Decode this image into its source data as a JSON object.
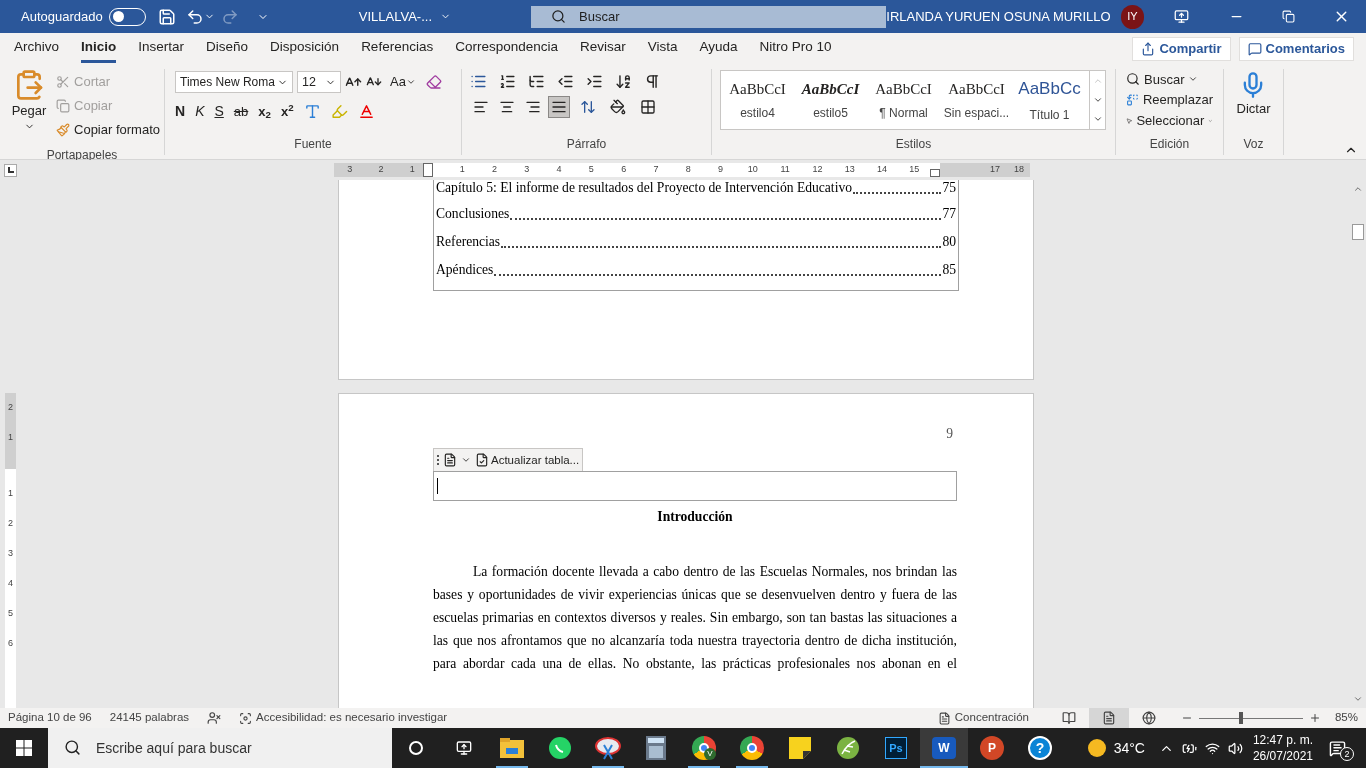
{
  "title_bar": {
    "autosave_label": "Autoguardado",
    "autosave_on": false,
    "file_name": "VILLALVA-...",
    "search_placeholder": "Buscar",
    "user_name": "IRLANDA YURUEN OSUNA MURILLO",
    "avatar_initials": "IY"
  },
  "menu_tabs": [
    {
      "label": "Archivo",
      "selected": false
    },
    {
      "label": "Inicio",
      "selected": true
    },
    {
      "label": "Insertar",
      "selected": false
    },
    {
      "label": "Diseño",
      "selected": false
    },
    {
      "label": "Disposición",
      "selected": false
    },
    {
      "label": "Referencias",
      "selected": false
    },
    {
      "label": "Correspondencia",
      "selected": false
    },
    {
      "label": "Revisar",
      "selected": false
    },
    {
      "label": "Vista",
      "selected": false
    },
    {
      "label": "Ayuda",
      "selected": false
    },
    {
      "label": "Nitro Pro 10",
      "selected": false
    }
  ],
  "share_button": "Compartir",
  "comments_button": "Comentarios",
  "clipboard": {
    "paste": "Pegar",
    "cut": {
      "label": "Cortar",
      "disabled": true
    },
    "copy": {
      "label": "Copiar",
      "disabled": true
    },
    "format_painter": {
      "label": "Copiar formato",
      "disabled": false
    },
    "group_label": "Portapapeles"
  },
  "font": {
    "font_name": "Times New Roma",
    "font_size": "12",
    "change_case": "Aa",
    "bold": "N",
    "italic": "K",
    "underline": "S",
    "strikethrough": "ab",
    "subscript": "x$_{2}$",
    "superscript": "x$^{2}$",
    "group_label": "Fuente"
  },
  "paragraph": {
    "alignments": [
      {
        "kind": "left",
        "selected": false
      },
      {
        "kind": "center",
        "selected": false
      },
      {
        "kind": "right",
        "selected": false
      },
      {
        "kind": "justify",
        "selected": true
      }
    ],
    "group_label": "Párrafo"
  },
  "styles": {
    "items": [
      {
        "preview": "AaBbCcI",
        "label": "estilo4",
        "kind": "normal"
      },
      {
        "preview": "AaBbCcI",
        "label": "estilo5",
        "kind": "bold-italic"
      },
      {
        "preview": "AaBbCcI",
        "label": "¶ Normal",
        "kind": "normal"
      },
      {
        "preview": "AaBbCcI",
        "label": "Sin espaci...",
        "kind": "normal"
      },
      {
        "preview": "AaBbCc",
        "label": "Título 1",
        "kind": "heading"
      }
    ],
    "group_label": "Estilos"
  },
  "editing": {
    "find": "Buscar",
    "replace": "Reemplazar",
    "select": "Seleccionar",
    "group_label": "Edición"
  },
  "voice": {
    "dictate": "Dictar",
    "group_label": "Voz"
  },
  "ruler": {
    "left_labels": [
      "3",
      "2",
      "1"
    ],
    "body_labels": [
      "1",
      "2",
      "3",
      "4",
      "5",
      "6",
      "7",
      "8",
      "9",
      "10",
      "11",
      "12",
      "13",
      "14",
      "15"
    ],
    "far_labels": [
      "17",
      "18"
    ]
  },
  "vertical_ruler": {
    "top_labels": [
      "2",
      "1"
    ],
    "body_labels": [
      "1",
      "2",
      "3",
      "4",
      "5",
      "6"
    ]
  },
  "page_one": {
    "toc": [
      {
        "title": "Capítulo 5: El informe de resultados del Proyecto de Intervención Educativo",
        "page": "75"
      },
      {
        "title": "Conclusiones",
        "page": "77"
      },
      {
        "title": "Referencias",
        "page": "80"
      },
      {
        "title": "Apéndices",
        "page": "85"
      }
    ]
  },
  "page_two": {
    "page_number": "9",
    "toc_toolbar_button": "Actualizar tabla...",
    "heading": "Introducción",
    "paragraph": "La formación docente llevada a cabo dentro de las Escuelas Normales, nos brindan las bases y oportunidades de vivir experiencias únicas que se desenvuelven dentro y fuera de las escuelas primarias en contextos diversos y reales. Sin embargo, son tan bastas las situaciones a las que nos afrontamos que no alcanzaría toda nuestra trayectoria dentro de dicha institución, para abordar cada una de ellas. No obstante, las prácticas profesionales nos abonan en el"
  },
  "status_bar": {
    "page": "Página 10 de 96",
    "words": "24145 palabras",
    "accessibility": "Accesibilidad: es necesario investigar",
    "focus": "Concentración",
    "views": [
      {
        "kind": "read",
        "selected": false
      },
      {
        "kind": "print",
        "selected": true
      },
      {
        "kind": "web",
        "selected": false
      }
    ],
    "zoom": {
      "level": 0.4
    },
    "zoom_percent": "85%"
  },
  "taskbar": {
    "search_placeholder": "Escribe aquí para buscar",
    "apps": [
      {
        "kind": "folder",
        "open": true,
        "active": false
      },
      {
        "kind": "chat",
        "open": false,
        "active": false
      },
      {
        "kind": "snip",
        "open": true,
        "active": false
      },
      {
        "kind": "calculator",
        "open": false,
        "active": false
      },
      {
        "kind": "browser",
        "letter": "V",
        "open": true,
        "active": false
      },
      {
        "kind": "browser",
        "open": true,
        "active": false
      },
      {
        "kind": "note",
        "open": false,
        "active": false
      },
      {
        "kind": "leaf",
        "open": false,
        "active": false
      },
      {
        "kind": "tile",
        "letter": "Ps",
        "open": false,
        "active": false
      },
      {
        "kind": "word",
        "letter": "W",
        "open": true,
        "active": true
      },
      {
        "kind": "slides",
        "letter": "P",
        "open": false,
        "active": false
      },
      {
        "kind": "help",
        "letter": "?",
        "open": false,
        "active": false
      }
    ],
    "temperature": "34°C",
    "time": "12:47 p. m.",
    "date": "26/07/2021",
    "notifications": "2"
  }
}
